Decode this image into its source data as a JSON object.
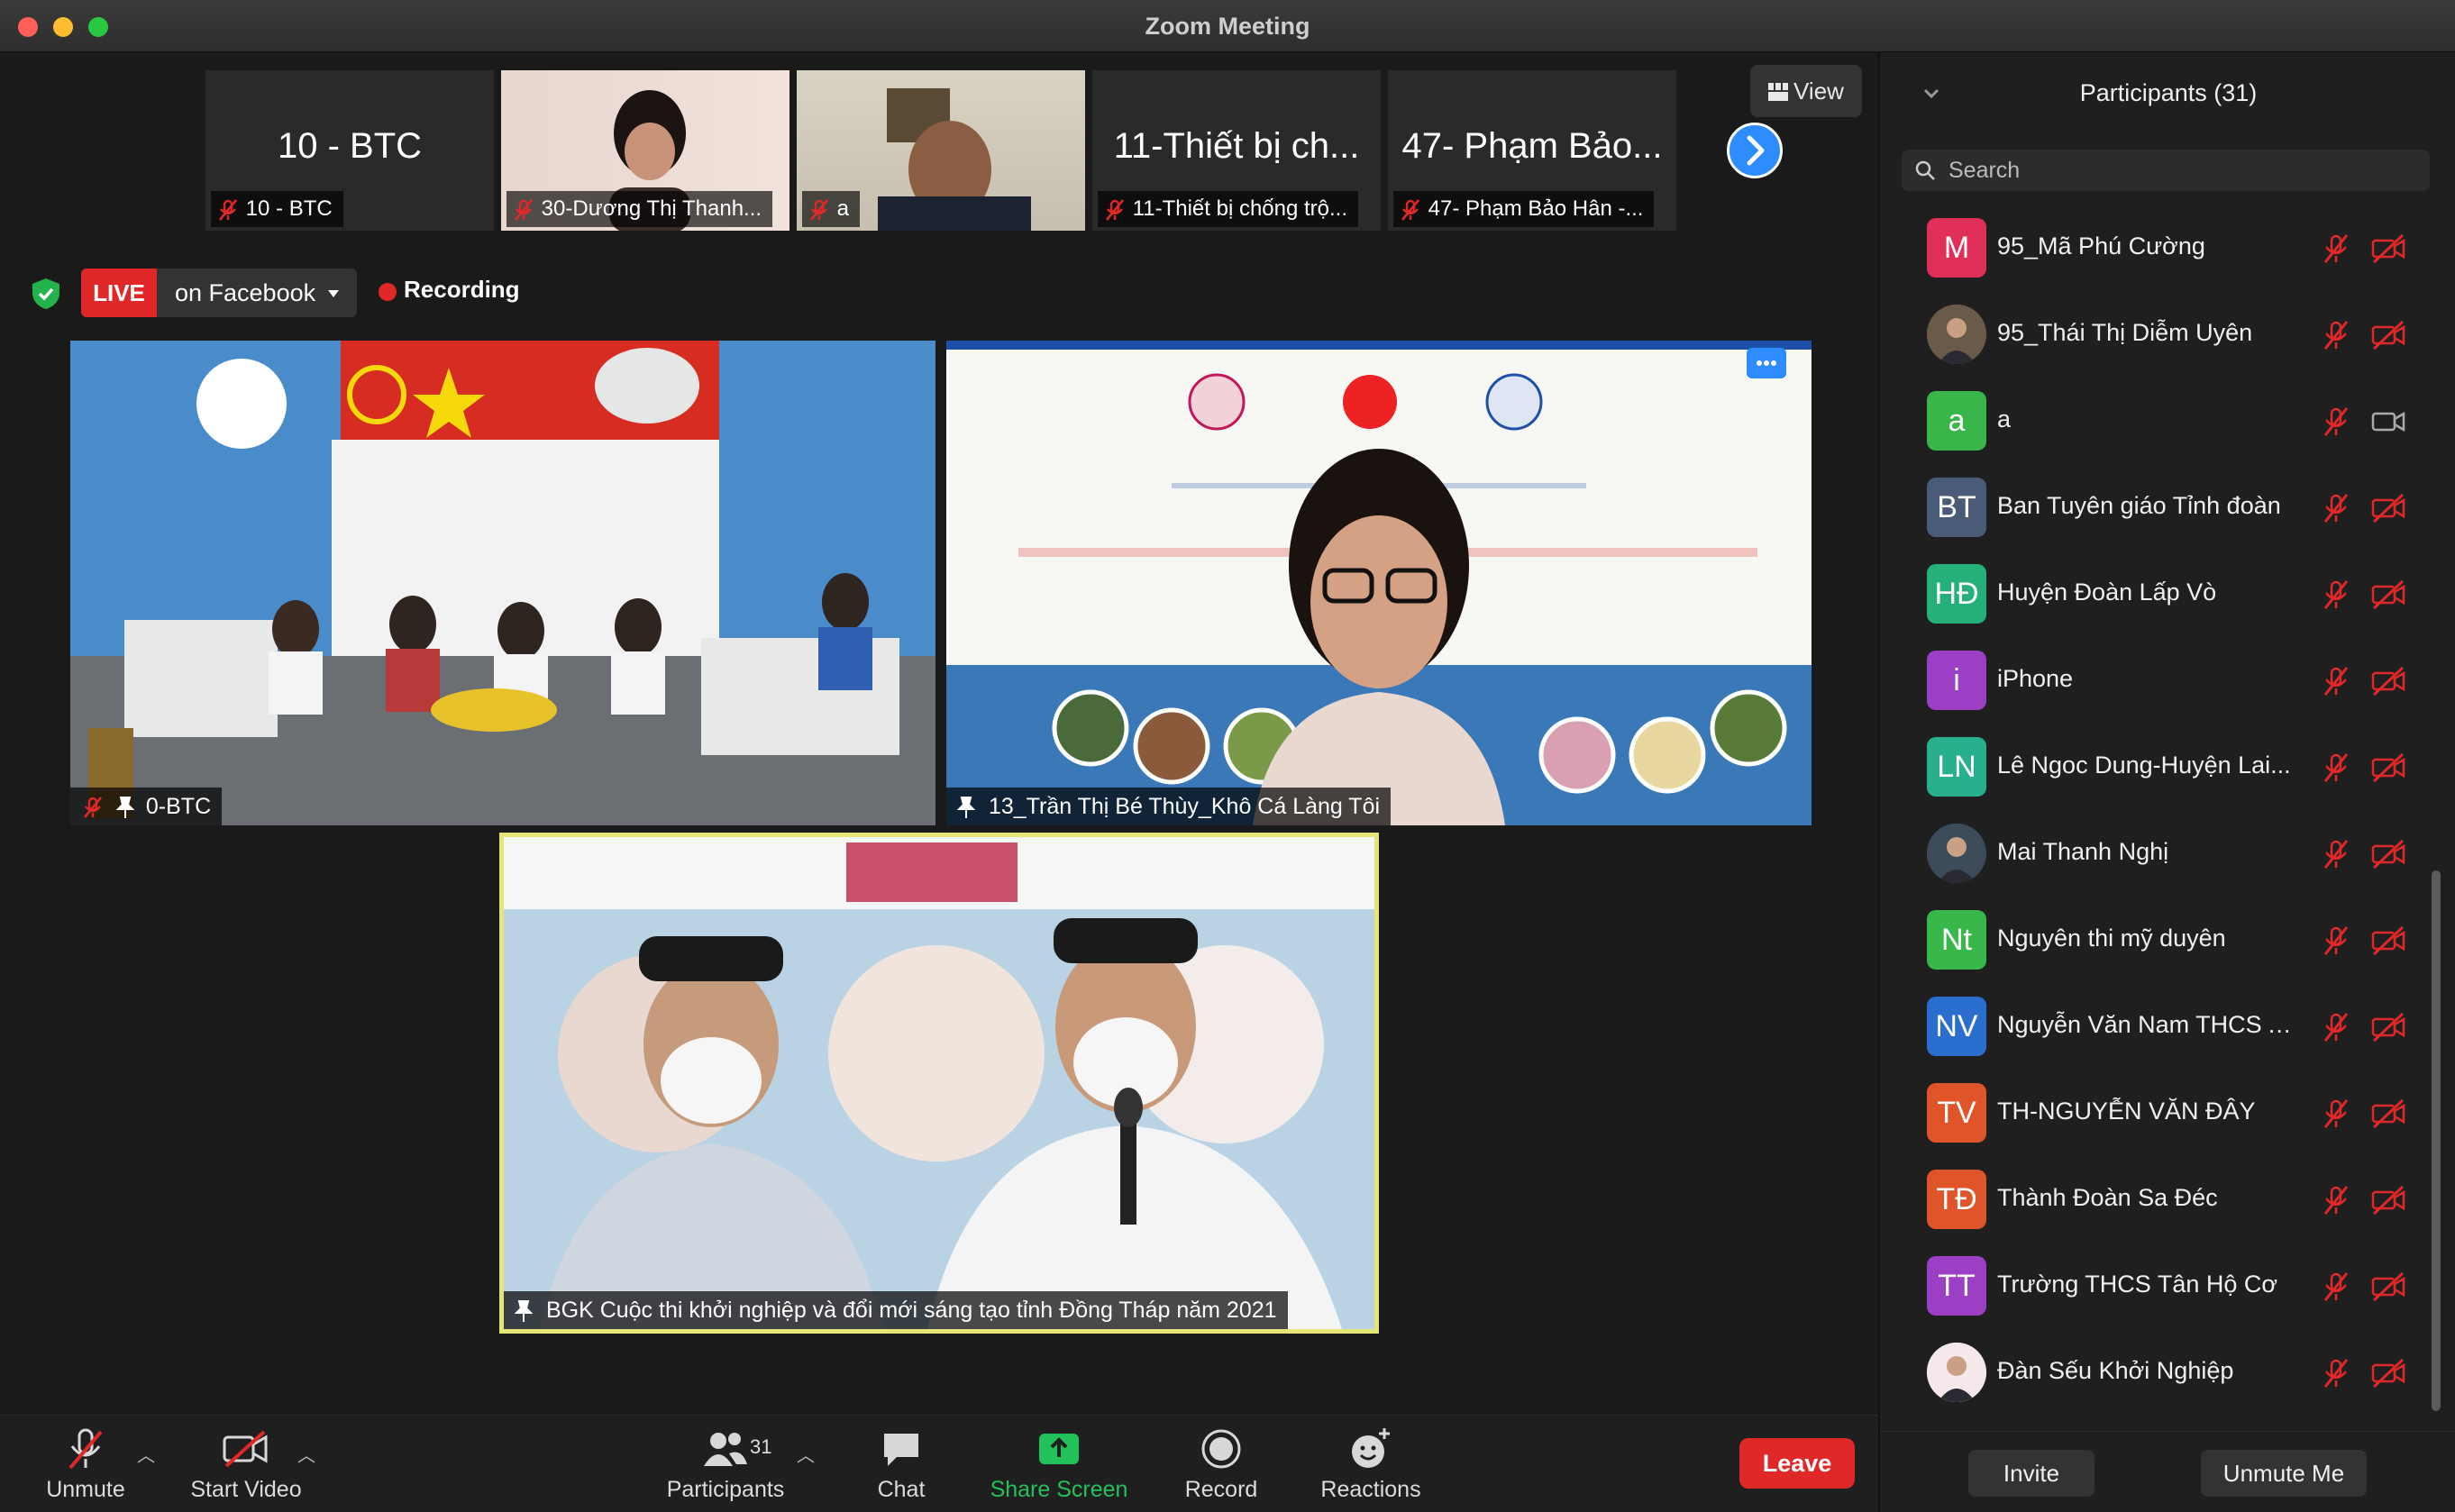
{
  "window": {
    "title": "Zoom Meeting"
  },
  "thumbnails": [
    {
      "big_label": "10 - BTC",
      "caption": "10 - BTC",
      "muted": true,
      "video": false
    },
    {
      "big_label": "",
      "caption": "30-Dương Thị Thanh...",
      "muted": true,
      "video": true
    },
    {
      "big_label": "",
      "caption": "a",
      "muted": true,
      "video": true
    },
    {
      "big_label": "11-Thiết bị ch...",
      "caption": "11-Thiết bị chống trộ...",
      "muted": true,
      "video": false
    },
    {
      "big_label": "47- Phạm Bảo...",
      "caption": "47- Phạm Bảo Hân -...",
      "muted": true,
      "video": false
    }
  ],
  "view_button": "View",
  "live": {
    "badge": "LIVE",
    "destination": "on Facebook",
    "recording": "Recording"
  },
  "tiles": {
    "left_caption": "0-BTC",
    "right_caption": "13_Trần Thị Bé Thùy_Khô Cá Làng Tôi",
    "bottom_caption": "BGK Cuộc thi khởi nghiệp và đổi mới sáng tạo tỉnh Đồng Tháp năm 2021"
  },
  "toolbar": {
    "unmute": "Unmute",
    "start_video": "Start Video",
    "participants": "Participants",
    "participants_count": "31",
    "chat": "Chat",
    "share_screen": "Share Screen",
    "record": "Record",
    "reactions": "Reactions",
    "leave": "Leave"
  },
  "panel": {
    "title": "Participants (31)",
    "search_placeholder": "Search",
    "participants": [
      {
        "initials": "M",
        "name": "95_Mã Phú Cường",
        "color": "#e0305a",
        "photo": false,
        "video_on": false
      },
      {
        "initials": "",
        "name": "95_Thái Thị Diễm Uyên",
        "color": "#6a5a4a",
        "photo": true,
        "video_on": false
      },
      {
        "initials": "a",
        "name": "a",
        "color": "#39b54a",
        "photo": false,
        "video_on": true
      },
      {
        "initials": "BT",
        "name": "Ban Tuyên giáo Tỉnh đoàn",
        "color": "#4a5b78",
        "photo": false,
        "video_on": false
      },
      {
        "initials": "HĐ",
        "name": "Huyện Đoàn Lấp Vò",
        "color": "#25b07a",
        "photo": false,
        "video_on": false
      },
      {
        "initials": "i",
        "name": "iPhone",
        "color": "#9b3fc4",
        "photo": false,
        "video_on": false
      },
      {
        "initials": "LN",
        "name": "Lê Ngoc Dung-Huyện Lai...",
        "color": "#28b08c",
        "photo": false,
        "video_on": false
      },
      {
        "initials": "",
        "name": "Mai Thanh Nghị",
        "color": "#3c4a5a",
        "photo": true,
        "video_on": false
      },
      {
        "initials": "Nt",
        "name": "Nguyên thi mỹ duyên",
        "color": "#38b84a",
        "photo": false,
        "video_on": false
      },
      {
        "initials": "NV",
        "name": "Nguyễn Văn Nam THCS A...",
        "color": "#2a6fd0",
        "photo": false,
        "video_on": false
      },
      {
        "initials": "TV",
        "name": "TH-NGUYỄN VĂN ĐÂY",
        "color": "#e0542a",
        "photo": false,
        "video_on": false
      },
      {
        "initials": "TĐ",
        "name": "Thành Đoàn Sa Đéc",
        "color": "#e0542a",
        "photo": false,
        "video_on": false
      },
      {
        "initials": "TT",
        "name": "Trường THCS Tân Hộ Cơ",
        "color": "#9b3fc4",
        "photo": false,
        "video_on": false
      },
      {
        "initials": "",
        "name": "Đàn Sếu Khởi Nghiệp",
        "color": "#f4e8ea",
        "photo": true,
        "video_on": false
      }
    ],
    "invite": "Invite",
    "unmute_me": "Unmute Me"
  }
}
